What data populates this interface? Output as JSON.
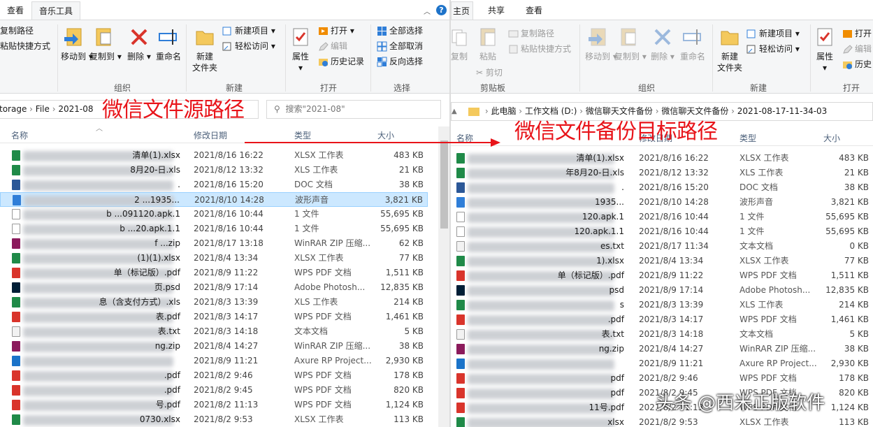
{
  "annotations": {
    "source": "微信文件源路径",
    "target": "微信文件备份目标路径",
    "watermark": "头条 @西米正版软件"
  },
  "left": {
    "tabs": [
      "查看",
      "音乐工具"
    ],
    "ribbon": {
      "copy_path": "复制路径",
      "paste_shortcut": "粘贴快捷方式",
      "move_to": "移动到",
      "copy_to": "复制到",
      "delete": "删除",
      "rename": "重命名",
      "new_folder_1": "新建",
      "new_folder_2": "文件夹",
      "new_item": "新建项目",
      "easy_access": "轻松访问",
      "properties": "属性",
      "open": "打开",
      "edit": "编辑",
      "history": "历史记录",
      "select_all": "全部选择",
      "select_none": "全部取消",
      "invert": "反向选择",
      "grp_organize": "组织",
      "grp_new": "新建",
      "grp_open": "打开",
      "grp_select": "选择"
    },
    "address": [
      "torage",
      "File",
      "2021-08"
    ],
    "search_placeholder": "搜索\"2021-08\"",
    "columns": {
      "name": "名称",
      "date": "修改日期",
      "type": "类型",
      "size": "大小"
    },
    "rows": [
      {
        "name": "清单(1).xlsx",
        "date": "2021/8/16 16:22",
        "type": "XLSX 工作表",
        "size": "483 KB",
        "icon": "xlsx"
      },
      {
        "name": "8月20-日.xls",
        "date": "2021/8/12 13:32",
        "type": "XLS 工作表",
        "size": "21 KB",
        "icon": "xls"
      },
      {
        "name": ".",
        "date": "2021/8/16 15:20",
        "type": "DOC 文档",
        "size": "38 KB",
        "icon": "doc"
      },
      {
        "name": "2 ...1935...",
        "date": "2021/8/10 14:28",
        "type": "波形声音",
        "size": "3,821 KB",
        "icon": "wav"
      },
      {
        "name": "b ...091120.apk.1",
        "date": "2021/8/16 10:44",
        "type": "1 文件",
        "size": "55,695 KB",
        "icon": "file"
      },
      {
        "name": "b ...20.apk.1.1",
        "date": "2021/8/16 10:44",
        "type": "1 文件",
        "size": "55,695 KB",
        "icon": "file"
      },
      {
        "name": "f ...zip",
        "date": "2021/8/17 13:18",
        "type": "WinRAR ZIP 压缩...",
        "size": "62 KB",
        "icon": "zip"
      },
      {
        "name": "(1)(1).xlsx",
        "date": "2021/8/4 13:34",
        "type": "XLSX 工作表",
        "size": "77 KB",
        "icon": "xlsx"
      },
      {
        "name": "单（标记版）.pdf",
        "date": "2021/8/9 11:22",
        "type": "WPS PDF 文档",
        "size": "1,511 KB",
        "icon": "pdf"
      },
      {
        "name": "页.psd",
        "date": "2021/8/9 17:14",
        "type": "Adobe Photosh...",
        "size": "12,835 KB",
        "icon": "psd"
      },
      {
        "name": "息（含支付方式）.xls",
        "date": "2021/8/3 13:39",
        "type": "XLS 工作表",
        "size": "214 KB",
        "icon": "xls"
      },
      {
        "name": "表.pdf",
        "date": "2021/8/3 14:17",
        "type": "WPS PDF 文档",
        "size": "1,461 KB",
        "icon": "pdf"
      },
      {
        "name": "表.txt",
        "date": "2021/8/3 14:18",
        "type": "文本文档",
        "size": "5 KB",
        "icon": "txt"
      },
      {
        "name": "ng.zip",
        "date": "2021/8/4 14:27",
        "type": "WinRAR ZIP 压缩...",
        "size": "38 KB",
        "icon": "zip"
      },
      {
        "name": "",
        "date": "2021/8/9 11:21",
        "type": "Axure RP Project...",
        "size": "2,930 KB",
        "icon": "rp"
      },
      {
        "name": ".pdf",
        "date": "2021/8/2 9:46",
        "type": "WPS PDF 文档",
        "size": "178 KB",
        "icon": "pdf"
      },
      {
        "name": ".pdf",
        "date": "2021/8/2 9:45",
        "type": "WPS PDF 文档",
        "size": "820 KB",
        "icon": "pdf"
      },
      {
        "name": "号.pdf",
        "date": "2021/8/2 11:13",
        "type": "WPS PDF 文档",
        "size": "1,124 KB",
        "icon": "pdf"
      },
      {
        "name": "0730.xlsx",
        "date": "2021/8/2 9:53",
        "type": "XLSX 工作表",
        "size": "113 KB",
        "icon": "xlsx"
      }
    ]
  },
  "right": {
    "tabs": [
      "主页",
      "共享",
      "查看"
    ],
    "ribbon": {
      "copy": "复制",
      "paste": "粘贴",
      "copy_path": "复制路径",
      "paste_shortcut": "粘贴快捷方式",
      "cut": "剪切",
      "move_to": "移动到",
      "copy_to": "复制到",
      "delete": "删除",
      "rename": "重命名",
      "new_folder_1": "新建",
      "new_folder_2": "文件夹",
      "new_item": "新建项目",
      "easy_access": "轻松访问",
      "properties": "属性",
      "open": "打开",
      "edit": "编辑",
      "history": "历史",
      "grp_clipboard": "剪贴板",
      "grp_organize": "组织",
      "grp_new": "新建",
      "grp_open": "打开"
    },
    "address": [
      "此电脑",
      "工作文档 (D:)",
      "微信聊天文件备份",
      "微信聊天文件备份",
      "2021-08-17-11-34-03"
    ],
    "columns": {
      "name": "名称",
      "date": "修改日期",
      "type": "类型",
      "size": "大小"
    },
    "rows": [
      {
        "name": "清单(1).xlsx",
        "date": "2021/8/16 16:22",
        "type": "XLSX 工作表",
        "size": "483 KB",
        "icon": "xlsx"
      },
      {
        "name": "年8月20-日.xls",
        "date": "2021/8/12 13:32",
        "type": "XLS 工作表",
        "size": "21 KB",
        "icon": "xls"
      },
      {
        "name": ".",
        "date": "2021/8/16 15:20",
        "type": "DOC 文档",
        "size": "38 KB",
        "icon": "doc"
      },
      {
        "name": "1935...",
        "date": "2021/8/10 14:28",
        "type": "波形声音",
        "size": "3,821 KB",
        "icon": "wav"
      },
      {
        "name": "120.apk.1",
        "date": "2021/8/16 10:44",
        "type": "1 文件",
        "size": "55,695 KB",
        "icon": "file"
      },
      {
        "name": "120.apk.1.1",
        "date": "2021/8/16 10:44",
        "type": "1 文件",
        "size": "55,695 KB",
        "icon": "file"
      },
      {
        "name": "es.txt",
        "date": "2021/8/17 11:34",
        "type": "文本文档",
        "size": "0 KB",
        "icon": "txt"
      },
      {
        "name": "1).xlsx",
        "date": "2021/8/4 13:34",
        "type": "XLSX 工作表",
        "size": "77 KB",
        "icon": "xlsx"
      },
      {
        "name": "单（标记版）.pdf",
        "date": "2021/8/9 11:22",
        "type": "WPS PDF 文档",
        "size": "1,511 KB",
        "icon": "pdf"
      },
      {
        "name": "psd",
        "date": "2021/8/9 17:14",
        "type": "Adobe Photosh...",
        "size": "12,835 KB",
        "icon": "psd"
      },
      {
        "name": "s",
        "date": "2021/8/3 13:39",
        "type": "XLS 工作表",
        "size": "214 KB",
        "icon": "xls"
      },
      {
        "name": ".pdf",
        "date": "2021/8/3 14:17",
        "type": "WPS PDF 文档",
        "size": "1,461 KB",
        "icon": "pdf"
      },
      {
        "name": "表.txt",
        "date": "2021/8/3 14:18",
        "type": "文本文档",
        "size": "5 KB",
        "icon": "txt"
      },
      {
        "name": "ng.zip",
        "date": "2021/8/4 14:27",
        "type": "WinRAR ZIP 压缩...",
        "size": "38 KB",
        "icon": "zip"
      },
      {
        "name": "",
        "date": "2021/8/9 11:21",
        "type": "Axure RP Project...",
        "size": "2,930 KB",
        "icon": "rp"
      },
      {
        "name": "pdf",
        "date": "2021/8/2 9:46",
        "type": "WPS PDF 文档",
        "size": "178 KB",
        "icon": "pdf"
      },
      {
        "name": "pdf",
        "date": "2021/8/2 9:45",
        "type": "WPS PDF 文档",
        "size": "820 KB",
        "icon": "pdf"
      },
      {
        "name": "11号.pdf",
        "date": "2021/8/2 11:13",
        "type": "WPS PDF 文档",
        "size": "1,124 KB",
        "icon": "pdf"
      },
      {
        "name": "xlsx",
        "date": "2021/8/2 9:53",
        "type": "XLSX 工作表",
        "size": "113 KB",
        "icon": "xlsx"
      }
    ]
  },
  "icon_colors": {
    "xlsx": "#1f8a48",
    "xls": "#1f8a48",
    "doc": "#2b5797",
    "wav": "#2f7ed8",
    "file": "#ffffff",
    "zip": "#8b1a5c",
    "pdf": "#d9342b",
    "psd": "#001e36",
    "txt": "#f2f2f2",
    "rp": "#1a73c9"
  },
  "colors": {
    "accent": "#0078d7",
    "annotation": "#e8141a",
    "selection": "#cce8ff"
  }
}
